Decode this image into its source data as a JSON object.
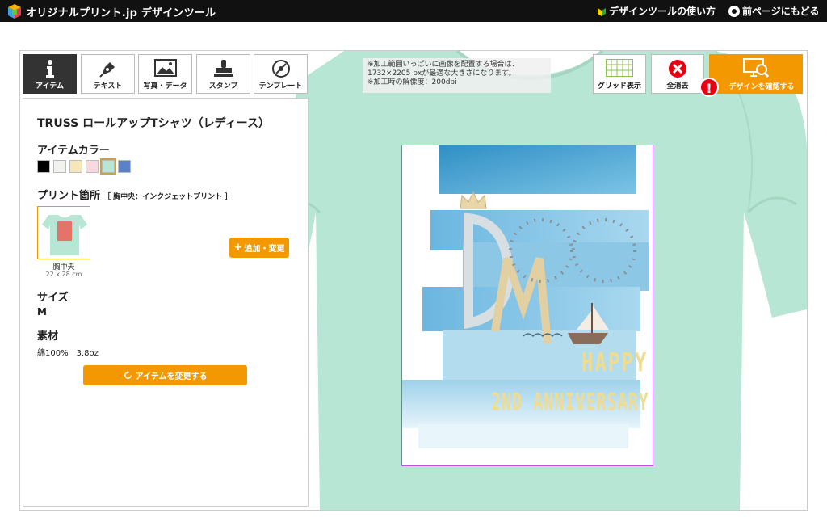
{
  "header": {
    "brand": "オリジナルプリント.jp デザインツール",
    "guide_link": "デザインツールの使い方",
    "back_link": "前ページにもどる"
  },
  "tabs": [
    {
      "label": "アイテム",
      "icon": "info-icon",
      "active": true
    },
    {
      "label": "テキスト",
      "icon": "pen-icon",
      "active": false
    },
    {
      "label": "写真・データ",
      "icon": "image-icon",
      "active": false
    },
    {
      "label": "スタンプ",
      "icon": "stamp-icon",
      "active": false
    },
    {
      "label": "テンプレート",
      "icon": "template-icon",
      "active": false
    }
  ],
  "item": {
    "product_name": "TRUSS ロールアップTシャツ（レディース）",
    "color_title": "アイテムカラー",
    "colors": [
      "#000000",
      "#f2f2ee",
      "#f5e8b8",
      "#f9d9e0",
      "#b8e6d4",
      "#5b82c8"
    ],
    "selected_color": "#b8e6d4",
    "print_title": "プリント箇所",
    "print_location_detail": "［ 胸中央：インクジェットプリント ］",
    "area_name": "胸中央",
    "area_size": "22 x 28 cm",
    "add_button": "追加・変更",
    "size_title": "サイズ",
    "size_value": "M",
    "material_title": "素材",
    "material_value": "綿100%　3.8oz",
    "change_button": "アイテムを変更する"
  },
  "notice": {
    "line1": "※加工範囲いっぱいに画像を配置する場合は、",
    "line2": "1732×2205 pxが最適な大きさになります。",
    "line3": "※加工時の解像度：200dpi"
  },
  "toolbar": {
    "grid_label": "グリッド表示",
    "clear_label": "全消去",
    "confirm_label": "デザインを確認する"
  },
  "design": {
    "happy_text": "HAPPY",
    "anniv_text": "2ND ANNIVERSARY",
    "monogram": "DM"
  },
  "shirt_color": "#b8e6d4"
}
